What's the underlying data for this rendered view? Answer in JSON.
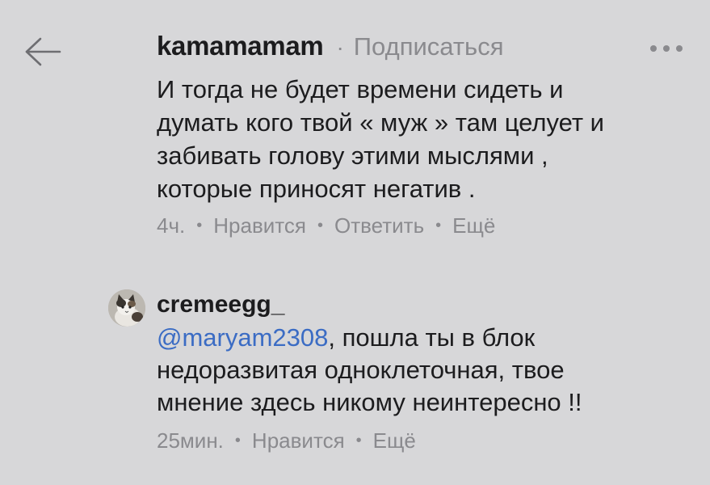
{
  "nav": {
    "back_icon": "arrow-left-icon",
    "more_icon": "more-horizontal-icon"
  },
  "comment1": {
    "username": "kamamamam",
    "dot": "·",
    "subscribe_label": "Подписаться",
    "text": "И тогда не будет времени сидеть и\nдумать кого твой « муж » там целует и\nзабивать голову этими мыслями ,\nкоторые приносят негатив .",
    "time": "4ч.",
    "like_label": "Нравится",
    "reply_label": "Ответить",
    "more_label": "Ещё"
  },
  "comment2": {
    "avatar_icon": "cat-avatar",
    "username": "cremeegg_",
    "mention": "@maryam2308",
    "text": ", пошла ты в блок\nнедоразвитая одноклеточная, твое\nмнение здесь никому неинтересно !!",
    "time": "25мин.",
    "like_label": "Нравится",
    "more_label": "Ещё"
  },
  "colors": {
    "background": "#d7d7d9",
    "text": "#1c1c1e",
    "secondary": "#8a8a8e",
    "mention": "#3b6cc4"
  }
}
